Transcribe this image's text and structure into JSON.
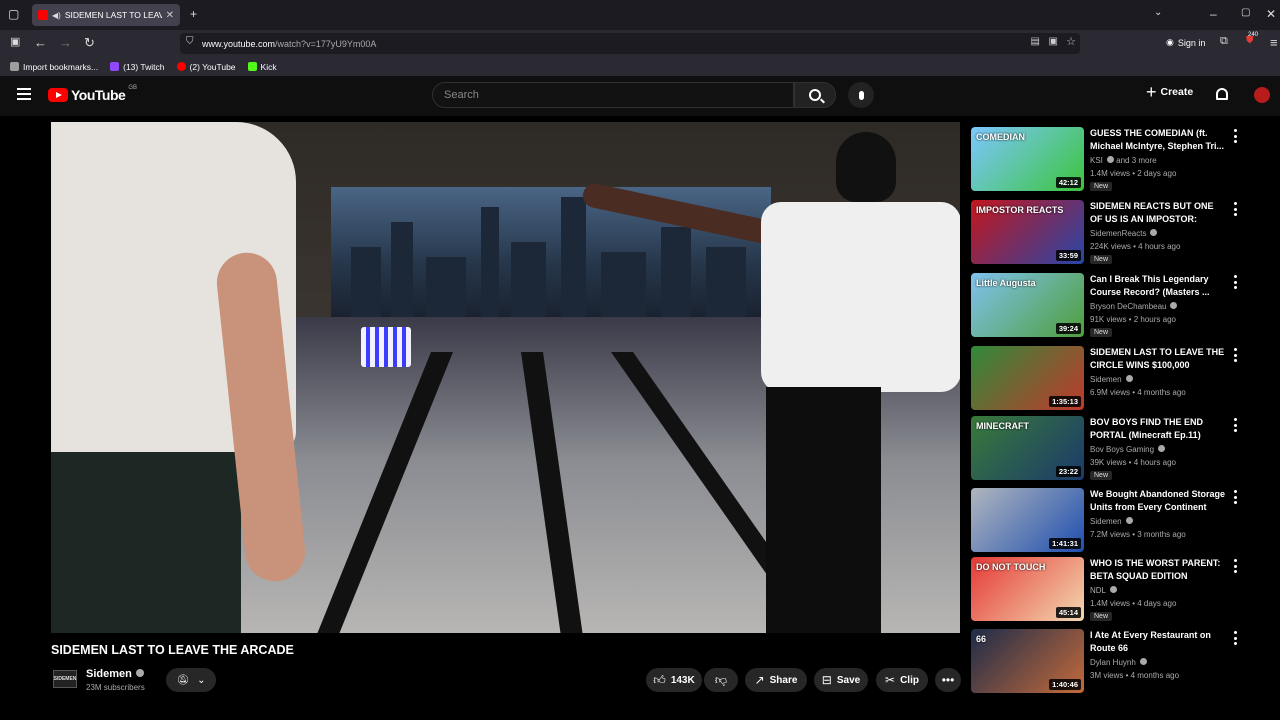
{
  "browser": {
    "tab_title": "SIDEMEN LAST TO LEAVE T",
    "url_host": "www.youtube.com",
    "url_path": "/watch?v=177yU9Ym00A",
    "sign_in": "Sign in",
    "badge_count": "240",
    "bookmarks": [
      {
        "label": "Import bookmarks...",
        "color": "#9e9e9e"
      },
      {
        "label": "(13) Twitch",
        "color": "#9146ff"
      },
      {
        "label": "(2) YouTube",
        "color": "#ff0000"
      },
      {
        "label": "Kick",
        "color": "#53fc18"
      }
    ]
  },
  "masthead": {
    "logo_text": "YouTube",
    "country_code": "GB",
    "search_placeholder": "Search",
    "create_label": "Create"
  },
  "video": {
    "title": "SIDEMEN LAST TO LEAVE THE ARCADE",
    "channel": {
      "name": "Sidemen",
      "subscribers": "23M subscribers",
      "avatar_text": "SIDEMEN"
    },
    "actions": {
      "likes": "143K",
      "share": "Share",
      "save": "Save",
      "clip": "Clip"
    }
  },
  "recommendations": [
    {
      "title": "GUESS THE COMEDIAN (ft. Michael McIntyre, Stephen Tri...",
      "channel": "KSI",
      "channel_extra": "and 3 more",
      "meta": "1.4M views • 2 days ago",
      "duration": "42:12",
      "is_new": true,
      "new_label": "New",
      "thumb_colors": [
        "#7cc7ff",
        "#3cc43c"
      ],
      "thumb_text": "COMEDIAN"
    },
    {
      "title": "SIDEMEN REACTS BUT ONE OF US IS AN IMPOSTOR: TIKTOK ...",
      "channel": "SidemenReacts",
      "channel_extra": "",
      "meta": "224K views • 4 hours ago",
      "duration": "33:59",
      "is_new": true,
      "new_label": "New",
      "thumb_colors": [
        "#c4161c",
        "#2746a8"
      ],
      "thumb_text": "IMPOSTOR REACTS"
    },
    {
      "title": "Can I Break This Legendary Course Record? (Masters ...",
      "channel": "Bryson DeChambeau",
      "channel_extra": "",
      "meta": "91K views • 2 hours ago",
      "duration": "39:24",
      "is_new": true,
      "new_label": "New",
      "thumb_colors": [
        "#7fc2ee",
        "#4f9e3a"
      ],
      "thumb_text": "Little Augusta"
    },
    {
      "title": "SIDEMEN LAST TO LEAVE THE CIRCLE WINS $100,000",
      "channel": "Sidemen",
      "channel_extra": "",
      "meta": "6.9M views • 4 months ago",
      "duration": "1:35:13",
      "is_new": false,
      "new_label": "",
      "thumb_colors": [
        "#2f8a3a",
        "#c0392b"
      ],
      "thumb_text": ""
    },
    {
      "title": "BOV BOYS FIND THE END PORTAL (Minecraft Ep.11)",
      "channel": "Bov Boys Gaming",
      "channel_extra": "",
      "meta": "39K views • 4 hours ago",
      "duration": "23:22",
      "is_new": true,
      "new_label": "New",
      "thumb_colors": [
        "#3a7a3a",
        "#1a3a6a"
      ],
      "thumb_text": "MINECRAFT"
    },
    {
      "title": "We Bought Abandoned Storage Units from Every Continent an...",
      "channel": "Sidemen",
      "channel_extra": "",
      "meta": "7.2M views • 3 months ago",
      "duration": "1:41:31",
      "is_new": false,
      "new_label": "",
      "thumb_colors": [
        "#b0b6bd",
        "#1f4fb0"
      ],
      "thumb_text": ""
    },
    {
      "title": "WHO IS THE WORST PARENT: BETA SQUAD EDITION",
      "channel": "NDL",
      "channel_extra": "",
      "meta": "1.4M views • 4 days ago",
      "duration": "45:14",
      "is_new": true,
      "new_label": "New",
      "thumb_colors": [
        "#e53935",
        "#f3d9b1"
      ],
      "thumb_text": "DO NOT TOUCH"
    },
    {
      "title": "I Ate At Every Restaurant on Route 66",
      "channel": "Dylan Huynh",
      "channel_extra": "",
      "meta": "3M views • 4 months ago",
      "duration": "1:40:46",
      "is_new": false,
      "new_label": "",
      "thumb_colors": [
        "#1d2c4a",
        "#c46a3a"
      ],
      "thumb_text": "66"
    }
  ]
}
